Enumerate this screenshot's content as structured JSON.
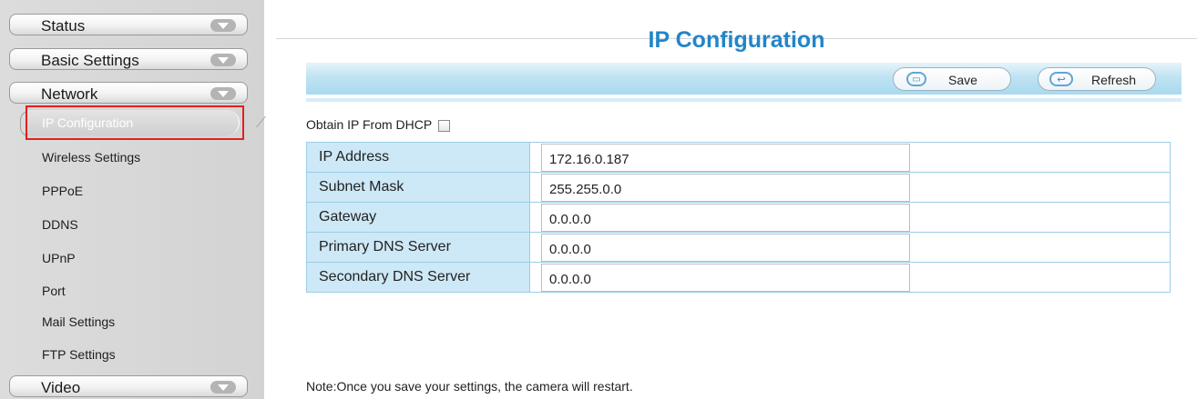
{
  "sidebar": {
    "menus": {
      "status": "Status",
      "basic_settings": "Basic Settings",
      "network": "Network",
      "video": "Video"
    },
    "network_items": [
      "IP Configuration",
      "Wireless Settings",
      "PPPoE",
      "DDNS",
      "UPnP",
      "Port",
      "Mail Settings",
      "FTP Settings"
    ],
    "active_item": "IP Configuration"
  },
  "page": {
    "title": "IP Configuration"
  },
  "toolbar": {
    "save_label": "Save",
    "refresh_label": "Refresh"
  },
  "dhcp": {
    "label": "Obtain IP From DHCP",
    "checked": false
  },
  "fields": [
    {
      "label": "IP Address",
      "value": "172.16.0.187"
    },
    {
      "label": "Subnet Mask",
      "value": "255.255.0.0"
    },
    {
      "label": "Gateway",
      "value": "0.0.0.0"
    },
    {
      "label": "Primary DNS Server",
      "value": "0.0.0.0"
    },
    {
      "label": "Secondary DNS Server",
      "value": "0.0.0.0"
    }
  ],
  "note": "Note:Once you save your settings, the camera will restart.",
  "colors": {
    "title": "#2385c8",
    "toolbar": "#bfe3f2",
    "label_cell": "#cde8f6",
    "highlight_border": "#e02020"
  }
}
